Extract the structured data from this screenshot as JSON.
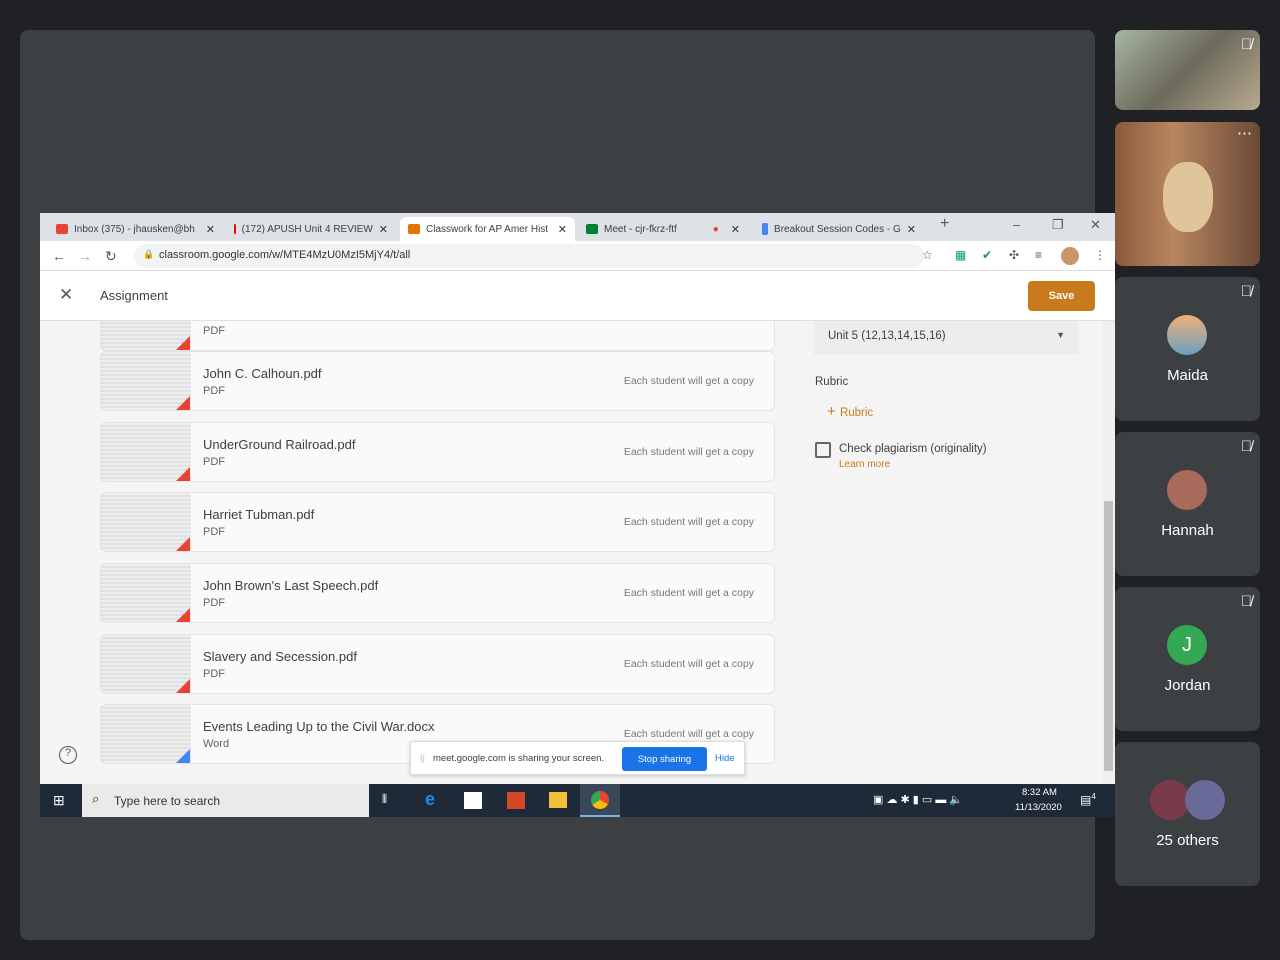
{
  "browser": {
    "tabs": [
      {
        "label": "Inbox (375) - jhausken@bh",
        "icon": "gmail-icon"
      },
      {
        "label": "(172) APUSH Unit 4 REVIEW",
        "icon": "youtube-icon"
      },
      {
        "label": "Classwork for AP Amer Hist",
        "icon": "classroom-icon"
      },
      {
        "label": "Meet - cjr-fkrz-ftf",
        "icon": "meet-icon"
      },
      {
        "label": "Breakout Session Codes - G",
        "icon": "docs-icon"
      }
    ],
    "url": "classroom.google.com/w/MTE4MzU0MzI5MjY4/t/all"
  },
  "app": {
    "title": "Assignment",
    "save_label": "Save"
  },
  "files": [
    {
      "name": "",
      "type": "PDF",
      "note": ""
    },
    {
      "name": "John C. Calhoun.pdf",
      "type": "PDF",
      "note": "Each student will get a copy"
    },
    {
      "name": "UnderGround Railroad.pdf",
      "type": "PDF",
      "note": "Each student will get a copy"
    },
    {
      "name": "Harriet Tubman.pdf",
      "type": "PDF",
      "note": "Each student will get a copy"
    },
    {
      "name": "John Brown's Last Speech.pdf",
      "type": "PDF",
      "note": "Each student will get a copy"
    },
    {
      "name": "Slavery and Secession.pdf",
      "type": "PDF",
      "note": "Each student will get a copy"
    },
    {
      "name": "Events Leading Up to the Civil War.docx",
      "type": "Word",
      "note": "Each student will get a copy"
    }
  ],
  "side": {
    "topic": "Unit 5 (12,13,14,15,16)",
    "rubric_label": "Rubric",
    "add_rubric": "Rubric",
    "plagiarism": "Check plagiarism (originality)",
    "learn_more": "Learn more"
  },
  "sharing": {
    "message": "meet.google.com is sharing your screen.",
    "stop": "Stop sharing",
    "hide": "Hide"
  },
  "taskbar": {
    "search": "Type here to search",
    "time": "8:32 AM",
    "date": "11/13/2020",
    "notifications": "4"
  },
  "participants": [
    {
      "name": "Maida"
    },
    {
      "name": "Hannah"
    },
    {
      "name": "Jordan",
      "initial": "J"
    },
    {
      "name": "25 others"
    }
  ],
  "colors": {
    "accent": "#e37400",
    "blue": "#1a73e8",
    "jordan": "#34a853"
  }
}
